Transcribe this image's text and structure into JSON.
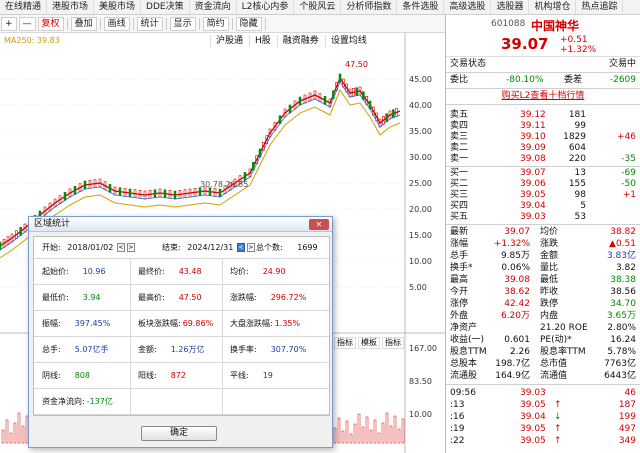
{
  "topnav": [
    "在线精通",
    "港股市场",
    "美股市场",
    "DDE决策",
    "资金流向",
    "L2核心内参",
    "个股风云",
    "分析师指数",
    "条件选股",
    "高级选股",
    "选股器",
    "机构增仓",
    "热点追踪"
  ],
  "toolbar": {
    "items": [
      "+",
      "—",
      "复权",
      "叠加",
      "画线",
      "统计",
      "显示",
      "简约",
      "隐藏"
    ],
    "fuquan_label": "复权",
    "chevron": "▼"
  },
  "chart": {
    "ma_text": "MA250: 39.83",
    "tabs": [
      "沪股通",
      "H股",
      "融资融券",
      "设置均线"
    ],
    "high_label": "47.50",
    "mid_label": "30.78 26.85",
    "y_labels": [
      "45.00",
      "40.00",
      "35.00",
      "30.00",
      "25.00",
      "20.00",
      "15.00",
      "10.00",
      "5.00"
    ],
    "low_label": "6",
    "vol_tabs": [
      "指标",
      "模板",
      "指标"
    ],
    "vol_labels": [
      "167.00",
      "83.50",
      "10.00"
    ],
    "vol_low": "0.00"
  },
  "dialog": {
    "title": "区域统计",
    "close": "✕",
    "start_label": "开始:",
    "start_date": "2018/01/02",
    "end_label": "结束:",
    "end_date": "2024/12/31",
    "total_label": "总个数:",
    "total_value": "1699",
    "rows": [
      [
        {
          "k": "起始价:",
          "v": "10.96",
          "c": "blue"
        },
        {
          "k": "最终价:",
          "v": "43.48",
          "c": "red"
        },
        {
          "k": "均价:",
          "v": "24.90",
          "c": "red"
        }
      ],
      [
        {
          "k": "最低价:",
          "v": "3.94",
          "c": "green"
        },
        {
          "k": "最高价:",
          "v": "47.50",
          "c": "red"
        },
        {
          "k": "涨跌幅:",
          "v": "296.72%",
          "c": "red"
        }
      ],
      [
        {
          "k": "振幅:",
          "v": "397.45%",
          "c": "blue"
        },
        {
          "k": "板块涨跌幅:",
          "v": "69.86%",
          "c": "red"
        },
        {
          "k": "大盘涨跌幅:",
          "v": "1.35%",
          "c": "red"
        }
      ],
      [
        {
          "k": "总手:",
          "v": "5.07亿手",
          "c": "blue"
        },
        {
          "k": "金额:",
          "v": "1.26万亿",
          "c": "blue"
        },
        {
          "k": "换手率:",
          "v": "307.70%",
          "c": "blue"
        }
      ],
      [
        {
          "k": "阴线:",
          "v": "808",
          "c": "green"
        },
        {
          "k": "阳线:",
          "v": "872",
          "c": "red"
        },
        {
          "k": "平线:",
          "v": "19",
          "c": "blue"
        }
      ],
      [
        {
          "k": "资金净流向:",
          "v": "-137亿",
          "c": "green"
        },
        {
          "k": "",
          "v": "",
          "c": "blue"
        },
        {
          "k": "",
          "v": "",
          "c": "blue"
        }
      ]
    ],
    "ok_label": "确定"
  },
  "stock": {
    "code": "601088",
    "name": "中国神华",
    "price": "39.07",
    "change": "+0.51",
    "pct": "+1.32%",
    "status_label": "交易状态",
    "status_value": "交易中",
    "weibi_label": "委比",
    "weibi_value": "-80.10%",
    "weicha_label": "委差",
    "weicha_value": "-2609",
    "buy_l2": "购买L2查看十档行情",
    "asks": [
      {
        "label": "卖五",
        "price": "39.12",
        "vol": "181",
        "diff": ""
      },
      {
        "label": "卖四",
        "price": "39.11",
        "vol": "99",
        "diff": ""
      },
      {
        "label": "卖三",
        "price": "39.10",
        "vol": "1829",
        "diff": "+46"
      },
      {
        "label": "卖二",
        "price": "39.09",
        "vol": "604",
        "diff": ""
      },
      {
        "label": "卖一",
        "price": "39.08",
        "vol": "220",
        "diff": "-35"
      }
    ],
    "bids": [
      {
        "label": "买一",
        "price": "39.07",
        "vol": "13",
        "diff": "-69"
      },
      {
        "label": "买二",
        "price": "39.06",
        "vol": "155",
        "diff": "-50"
      },
      {
        "label": "买三",
        "price": "39.05",
        "vol": "98",
        "diff": "+1"
      },
      {
        "label": "买四",
        "price": "39.04",
        "vol": "5",
        "diff": ""
      },
      {
        "label": "买五",
        "price": "39.03",
        "vol": "53",
        "diff": ""
      }
    ],
    "stats": [
      {
        "l1": "最新",
        "v1": "39.07",
        "c1": "red",
        "l2": "均价",
        "v2": "38.82",
        "c2": "red"
      },
      {
        "l1": "涨幅",
        "v1": "+1.32%",
        "c1": "red",
        "l2": "涨跌",
        "v2": "▲0.51",
        "c2": "red"
      },
      {
        "l1": "总手",
        "v1": "9.85万",
        "c1": "black",
        "l2": "金额",
        "v2": "3.83亿",
        "c2": "blue"
      },
      {
        "l1": "换手*",
        "v1": "0.06%",
        "c1": "black",
        "l2": "量比",
        "v2": "3.82",
        "c2": "black"
      },
      {
        "l1": "最高",
        "v1": "39.08",
        "c1": "red",
        "l2": "最低",
        "v2": "38.38",
        "c2": "green"
      },
      {
        "l1": "今开",
        "v1": "38.62",
        "c1": "red",
        "l2": "昨收",
        "v2": "38.56",
        "c2": "black"
      },
      {
        "l1": "涨停",
        "v1": "42.42",
        "c1": "red",
        "l2": "跌停",
        "v2": "34.70",
        "c2": "green"
      },
      {
        "l1": "外盘",
        "v1": "6.20万",
        "c1": "red",
        "l2": "内盘",
        "v2": "3.65万",
        "c2": "green"
      },
      {
        "l1": "净资产",
        "v1": "",
        "c1": "black",
        "l2": "21.20 ROE",
        "v2": "2.80%",
        "c2": "black"
      },
      {
        "l1": "收益(一)",
        "v1": "0.601",
        "c1": "black",
        "l2": "PE(动)*",
        "v2": "16.24",
        "c2": "black"
      },
      {
        "l1": "股息TTM",
        "v1": "2.26",
        "c1": "black",
        "l2": "股息率TTM",
        "v2": "5.78%",
        "c2": "black"
      },
      {
        "l1": "总股本",
        "v1": "198.7亿",
        "c1": "black",
        "l2": "总市值",
        "v2": "7763亿",
        "c2": "black"
      },
      {
        "l1": "流通股",
        "v1": "164.9亿",
        "c1": "black",
        "l2": "流通值",
        "v2": "6443亿",
        "c2": "black"
      }
    ],
    "ticks": [
      {
        "time": "09:56",
        "price": "39.03",
        "arrow": "",
        "vol": "46"
      },
      {
        "time": ":13",
        "price": "39.05",
        "arrow": "↑",
        "vol": "187"
      },
      {
        "time": ":16",
        "price": "39.04",
        "arrow": "↓",
        "vol": "199"
      },
      {
        "time": ":19",
        "price": "39.05",
        "arrow": "↑",
        "vol": "497"
      },
      {
        "time": ":22",
        "price": "39.05",
        "arrow": "↑",
        "vol": "349"
      }
    ]
  },
  "colors": {
    "red": "#d40000",
    "green": "#008a00",
    "blue": "#1a3ea8",
    "ma_yellow": "#d0a000"
  }
}
